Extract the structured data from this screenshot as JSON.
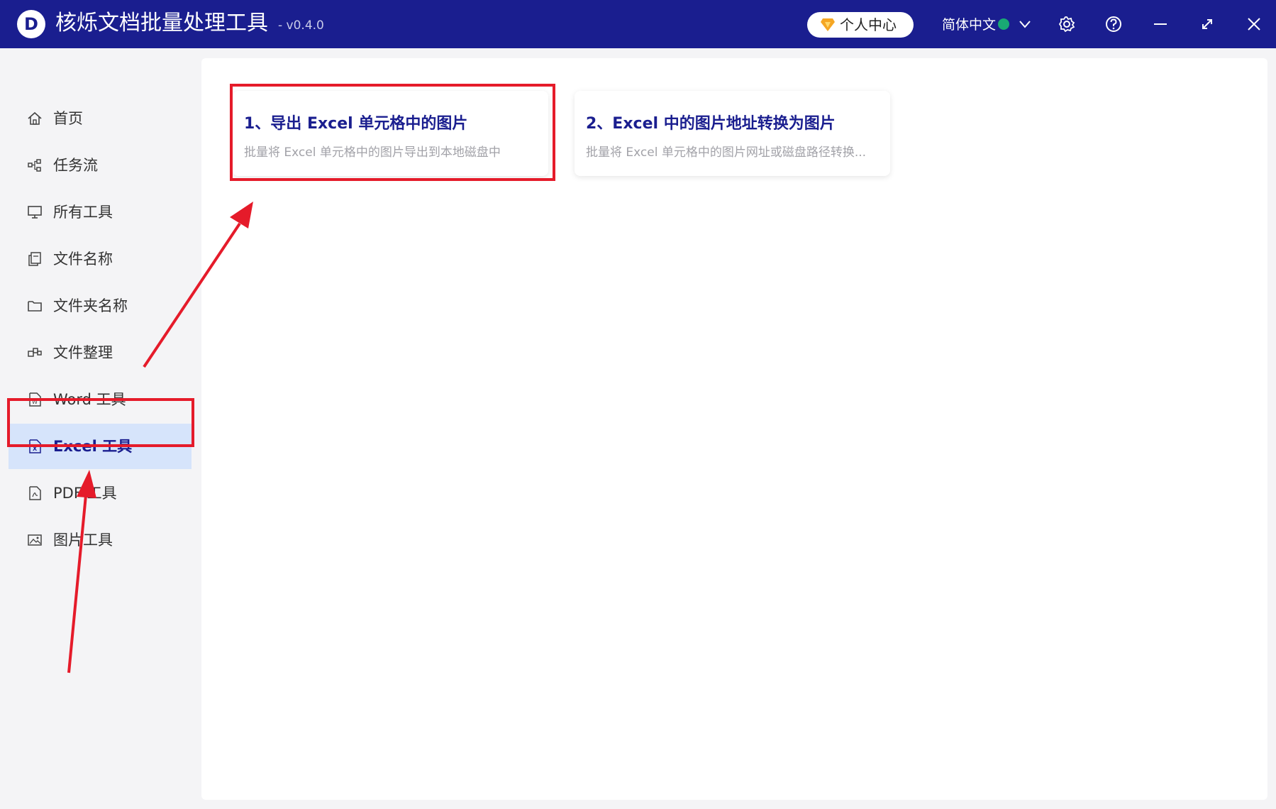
{
  "app": {
    "logo_letter": "D",
    "title": "核烁文档批量处理工具",
    "version": "- v0.4.0"
  },
  "titlebar": {
    "vip_label": "个人中心",
    "language": "简体中文",
    "icons": [
      "vip-gem-icon",
      "globe-icon",
      "chevron-down-icon",
      "gear-icon",
      "help-icon",
      "minimize-icon",
      "maximize-icon",
      "close-icon"
    ]
  },
  "sidebar": {
    "items": [
      {
        "label": "首页",
        "icon": "home-icon"
      },
      {
        "label": "任务流",
        "icon": "workflow-icon"
      },
      {
        "label": "所有工具",
        "icon": "monitor-icon"
      },
      {
        "label": "文件名称",
        "icon": "file-copy-icon"
      },
      {
        "label": "文件夹名称",
        "icon": "folder-icon"
      },
      {
        "label": "文件整理",
        "icon": "organize-icon"
      },
      {
        "label": "Word 工具",
        "icon": "word-file-icon"
      },
      {
        "label": "Excel 工具",
        "icon": "excel-file-icon"
      },
      {
        "label": "PDF 工具",
        "icon": "pdf-file-icon"
      },
      {
        "label": "图片工具",
        "icon": "image-icon"
      }
    ],
    "active": "Excel 工具"
  },
  "main": {
    "cards": [
      {
        "title": "1、导出 Excel 单元格中的图片",
        "desc": "批量将 Excel 单元格中的图片导出到本地磁盘中"
      },
      {
        "title": "2、Excel 中的图片地址转换为图片",
        "desc": "批量将 Excel 单元格中的图片网址或磁盘路径转换..."
      }
    ]
  },
  "colors": {
    "titlebar": "#1a1e8f",
    "accent_text": "#1a1e8f",
    "active_nav_bg": "#d6e4fb",
    "annotation_red": "#e51b2a",
    "vip_gem": "#f5a623"
  }
}
